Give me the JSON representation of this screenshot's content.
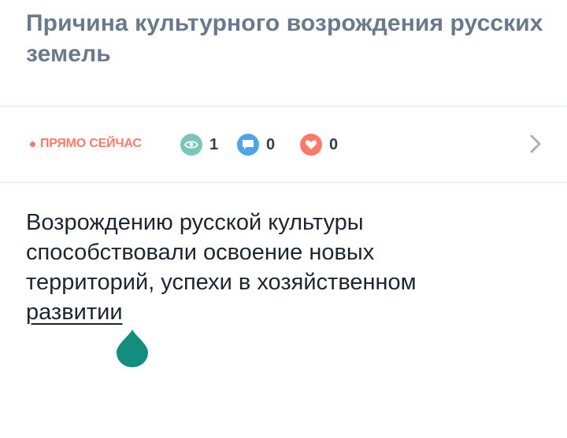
{
  "question": {
    "text": "Причина культурного возрождения русских земель"
  },
  "meta": {
    "live_label": "ПРЯМО СЕЙЧАС",
    "views_count": "1",
    "comments_count": "0",
    "likes_count": "0"
  },
  "answer": {
    "line1": "Возрождению русской культуры",
    "line2": "способствовали освоение новых",
    "line3": "территорий, успехи в хозяйственном",
    "link_text": "развитии"
  },
  "colors": {
    "question_text": "#687b8c",
    "live_red": "#ff796b",
    "views_green": "#4fb3a3",
    "comments_blue": "#4fa3e8",
    "likes_red": "#ff796b",
    "drop_teal": "#138d7e"
  },
  "icons": {
    "views": "eye-icon",
    "comments": "comment-bubble-icon",
    "likes": "heart-icon",
    "next": "chevron-right-icon",
    "marker": "drop-marker-icon"
  }
}
